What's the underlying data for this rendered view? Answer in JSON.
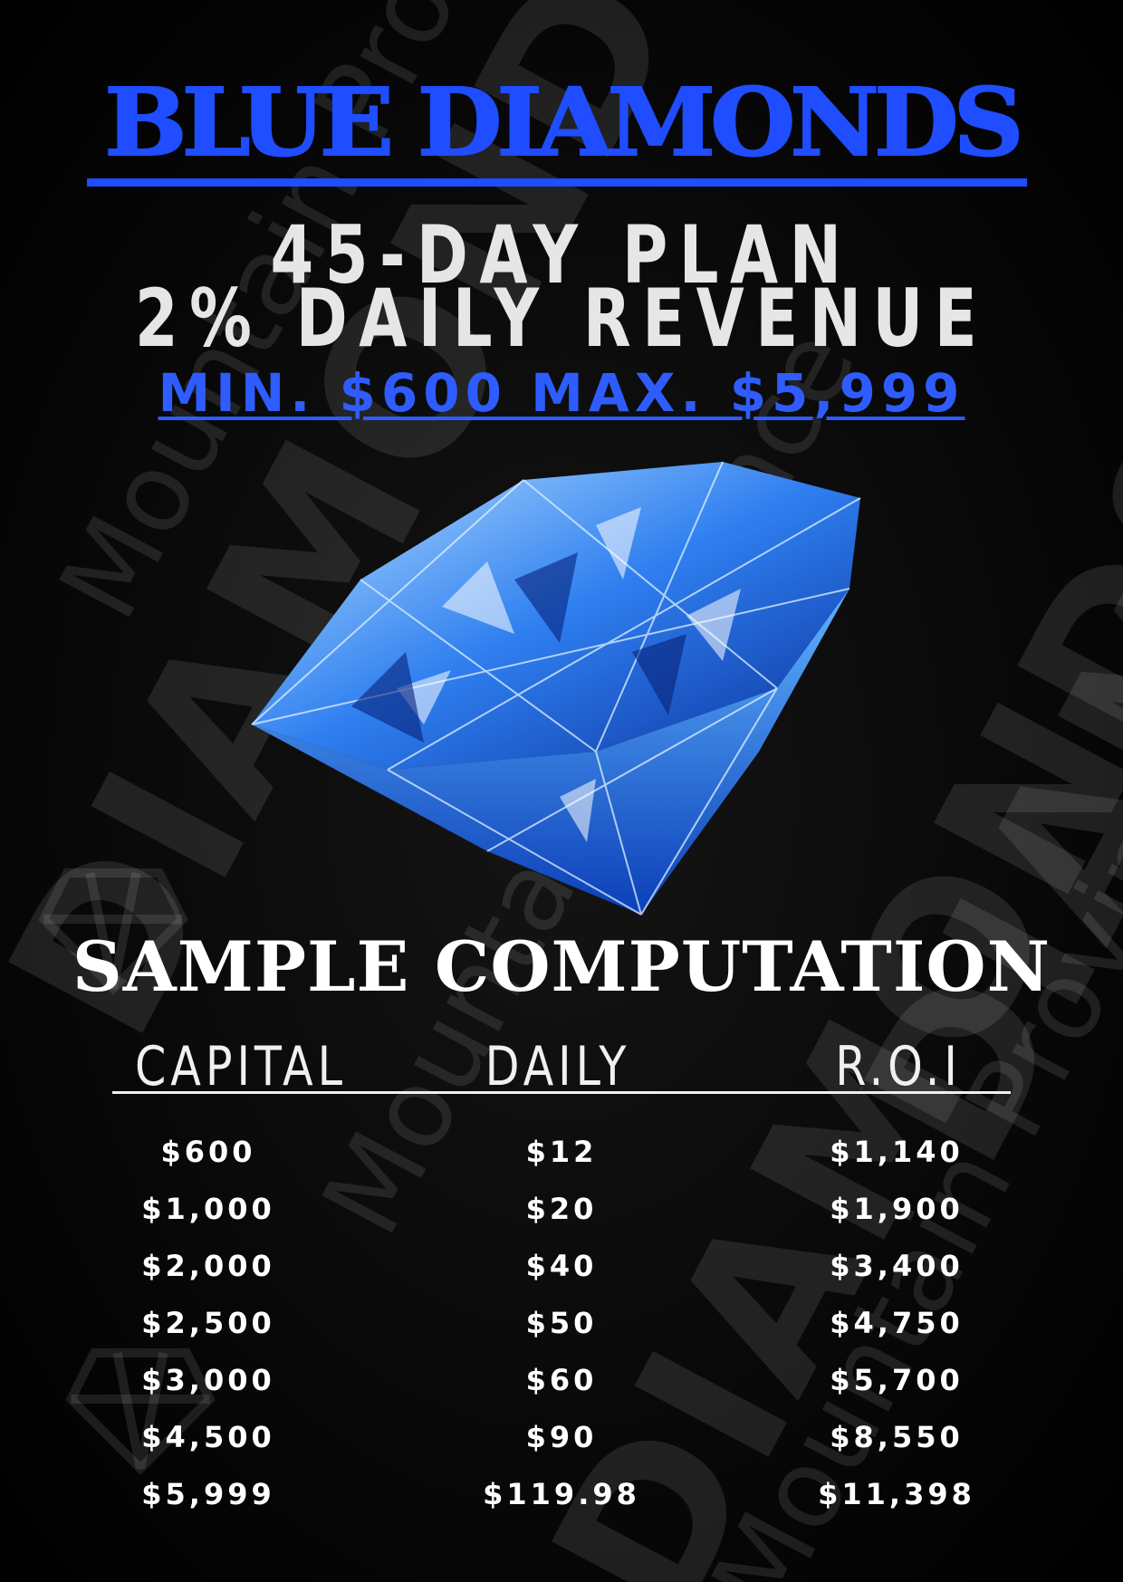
{
  "header": {
    "title": "BLUE DIAMONDS",
    "plan": "45-DAY PLAN",
    "revenue": "2% DAILY REVENUE",
    "limits": "MIN. $600 MAX. $5,999"
  },
  "watermark": {
    "brand": "DIAMONDS",
    "sub": "Mountain Province"
  },
  "computation": {
    "title": "SAMPLE COMPUTATION",
    "columns": [
      "CAPITAL",
      "DAILY",
      "R.O.I"
    ],
    "rows": [
      [
        "$600",
        "$12",
        "$1,140"
      ],
      [
        "$1,000",
        "$20",
        "$1,900"
      ],
      [
        "$2,000",
        "$40",
        "$3,400"
      ],
      [
        "$2,500",
        "$50",
        "$4,750"
      ],
      [
        "$3,000",
        "$60",
        "$5,700"
      ],
      [
        "$4,500",
        "$90",
        "$8,550"
      ],
      [
        "$5,999",
        "$119.98",
        "$11,398"
      ]
    ]
  },
  "colors": {
    "accent_blue": "#1f4dff",
    "text_light": "#e6e6e6",
    "background": "#050505"
  }
}
